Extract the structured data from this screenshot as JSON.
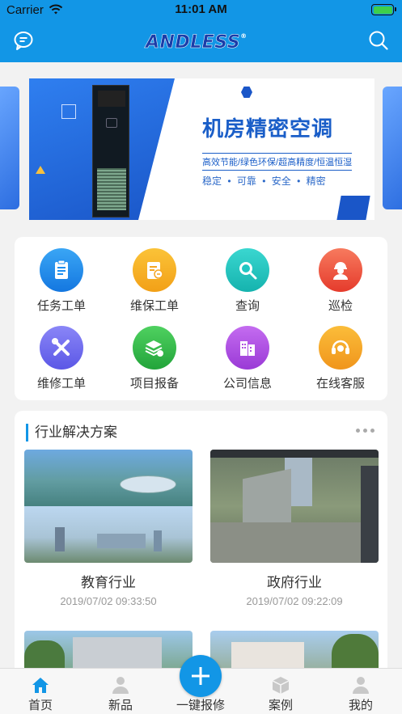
{
  "status_bar": {
    "carrier": "Carrier",
    "time": "11:01 AM"
  },
  "header": {
    "logo": "ANDLESS",
    "logo_mark": "®",
    "message_icon": "chat-bubble-icon",
    "search_icon": "search-icon"
  },
  "banner": {
    "title": "机房精密空调",
    "subtitle": "高效节能/绿色环保/超高精度/恒温恒湿",
    "features": "稳定 • 可靠 • 安全 • 精密"
  },
  "grid": [
    {
      "label": "任务工单",
      "icon": "clipboard-icon",
      "color": "#1e8ff0"
    },
    {
      "label": "维保工单",
      "icon": "maintenance-doc-icon",
      "color": "#f5a623"
    },
    {
      "label": "查询",
      "icon": "magnifier-icon",
      "color": "#1fc7c2"
    },
    {
      "label": "巡检",
      "icon": "inspector-icon",
      "color": "#f0523c"
    },
    {
      "label": "维修工单",
      "icon": "tools-icon",
      "color": "#6d6df0"
    },
    {
      "label": "项目报备",
      "icon": "layers-icon",
      "color": "#2fb84a"
    },
    {
      "label": "公司信息",
      "icon": "building-icon",
      "color": "#b04fe0"
    },
    {
      "label": "在线客服",
      "icon": "headset-icon",
      "color": "#f5a623"
    }
  ],
  "solutions": {
    "heading": "行业解决方案",
    "more_icon": "more-dots-icon",
    "items": [
      {
        "title": "教育行业",
        "date": "2019/07/02 09:33:50"
      },
      {
        "title": "政府行业",
        "date": "2019/07/02 09:22:09"
      }
    ]
  },
  "tabbar": [
    {
      "label": "首页",
      "icon": "home-icon"
    },
    {
      "label": "新品",
      "icon": "user-icon"
    },
    {
      "label": "一键报修",
      "icon": "plus-icon"
    },
    {
      "label": "案例",
      "icon": "box-icon"
    },
    {
      "label": "我的",
      "icon": "profile-icon"
    }
  ],
  "colors": {
    "primary": "#1296e6",
    "active_tab": "#1296e6",
    "inactive_tab": "#c8c8c8"
  }
}
